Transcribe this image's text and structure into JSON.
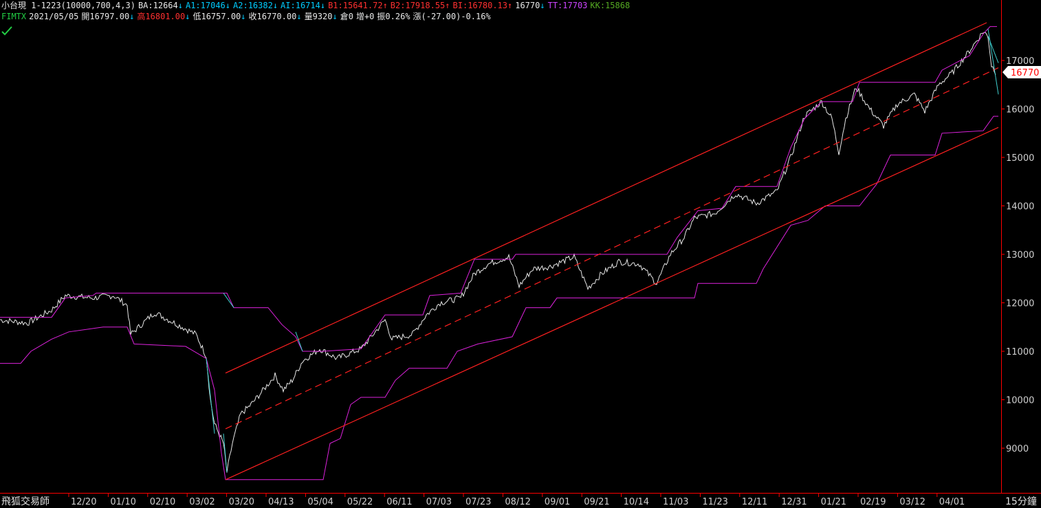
{
  "header1": [
    {
      "text": "小台現 1-1223(10000,700,4,3)",
      "color": "#e8e8e8"
    },
    {
      "text": "BA:12664",
      "color": "#e8e8e8",
      "arrow": "down"
    },
    {
      "text": "A1:17046",
      "color": "#00ccff",
      "arrow": "down"
    },
    {
      "text": "A2:16382",
      "color": "#00ccff",
      "arrow": "down"
    },
    {
      "text": "AI:16714",
      "color": "#00ccff",
      "arrow": "down"
    },
    {
      "text": "B1:15641.72",
      "color": "#ff3030",
      "arrow": "up"
    },
    {
      "text": "B2:17918.55",
      "color": "#ff3030",
      "arrow": "up"
    },
    {
      "text": "BI:16780.13",
      "color": "#ff3030",
      "arrow": "up"
    },
    {
      "text": "16770",
      "color": "#e8e8e8",
      "arrow": "down"
    },
    {
      "text": "TT:17703",
      "color": "#cc44ff"
    },
    {
      "text": "KK:15868",
      "color": "#55aa22"
    }
  ],
  "header2": [
    {
      "text": "FIMTX",
      "color": "#22cc44"
    },
    {
      "text": "2021/05/05",
      "color": "#e8e8e8"
    },
    {
      "text": "開16797.00",
      "color": "#e8e8e8",
      "arrow": "down"
    },
    {
      "text": "高16801.00",
      "color": "#ff3030",
      "arrow": "down"
    },
    {
      "text": "低16757.00",
      "color": "#e8e8e8",
      "arrow": "down"
    },
    {
      "text": "收16770.00",
      "color": "#e8e8e8",
      "arrow": "down"
    },
    {
      "text": "量9320",
      "color": "#e8e8e8",
      "arrow": "down"
    },
    {
      "text": "倉0",
      "color": "#e8e8e8"
    },
    {
      "text": "增+0",
      "color": "#e8e8e8"
    },
    {
      "text": "振0.26%",
      "color": "#e8e8e8"
    },
    {
      "text": "漲(-27.00)-0.16%",
      "color": "#e8e8e8"
    }
  ],
  "brand": "飛狐交易師",
  "timeframe": "15分鐘",
  "last_price_tag": "16770",
  "colors": {
    "background": "#000000",
    "price": "#e8e8e8",
    "channel": "#ff2020",
    "envelope": "#dd22dd",
    "cyan": "#40d0d0"
  },
  "chart_data": {
    "type": "line",
    "x_ticks": [
      "12/20",
      "01/10",
      "02/10",
      "03/02",
      "03/20",
      "04/13",
      "05/04",
      "05/22",
      "06/11",
      "07/03",
      "07/23",
      "08/12",
      "09/01",
      "09/21",
      "10/14",
      "11/03",
      "11/23",
      "12/11",
      "12/31",
      "01/21",
      "02/19",
      "03/12",
      "04/01"
    ],
    "y_ticks": [
      9000,
      10000,
      11000,
      12000,
      13000,
      14000,
      15000,
      16000,
      17000
    ],
    "ylim": [
      8300,
      17850
    ],
    "last_price": 16770,
    "series": [
      {
        "name": "",
        "points": [
          [
            0,
            11650
          ],
          [
            40,
            11580
          ],
          [
            75,
            11850
          ],
          [
            95,
            12150
          ],
          [
            135,
            12100
          ],
          [
            165,
            12150
          ],
          [
            185,
            11950
          ],
          [
            190,
            11350
          ],
          [
            225,
            11800
          ],
          [
            265,
            11500
          ],
          [
            285,
            11350
          ],
          [
            300,
            10900
          ],
          [
            306,
            10000
          ],
          [
            312,
            9500
          ],
          [
            325,
            9100
          ],
          [
            330,
            8500
          ],
          [
            338,
            9100
          ],
          [
            350,
            9700
          ],
          [
            365,
            9900
          ],
          [
            380,
            10150
          ],
          [
            400,
            10500
          ],
          [
            412,
            10200
          ],
          [
            425,
            10400
          ],
          [
            440,
            10800
          ],
          [
            465,
            11050
          ],
          [
            490,
            10850
          ],
          [
            525,
            11050
          ],
          [
            540,
            11300
          ],
          [
            560,
            11650
          ],
          [
            570,
            11250
          ],
          [
            600,
            11350
          ],
          [
            620,
            11750
          ],
          [
            640,
            12000
          ],
          [
            670,
            12100
          ],
          [
            690,
            12600
          ],
          [
            710,
            12800
          ],
          [
            740,
            12950
          ],
          [
            755,
            12350
          ],
          [
            775,
            12700
          ],
          [
            800,
            12750
          ],
          [
            835,
            12950
          ],
          [
            855,
            12300
          ],
          [
            875,
            12600
          ],
          [
            900,
            12850
          ],
          [
            930,
            12800
          ],
          [
            955,
            12400
          ],
          [
            975,
            13000
          ],
          [
            995,
            13350
          ],
          [
            1010,
            13750
          ],
          [
            1040,
            13850
          ],
          [
            1070,
            14250
          ],
          [
            1100,
            14050
          ],
          [
            1130,
            14300
          ],
          [
            1150,
            15000
          ],
          [
            1170,
            15850
          ],
          [
            1195,
            16150
          ],
          [
            1210,
            15800
          ],
          [
            1220,
            15100
          ],
          [
            1230,
            15800
          ],
          [
            1245,
            16450
          ],
          [
            1265,
            16000
          ],
          [
            1285,
            15650
          ],
          [
            1305,
            16100
          ],
          [
            1330,
            16300
          ],
          [
            1345,
            15950
          ],
          [
            1365,
            16500
          ],
          [
            1385,
            16750
          ],
          [
            1410,
            17200
          ],
          [
            1430,
            17600
          ],
          [
            1437,
            17500
          ],
          [
            1442,
            16900
          ],
          [
            1448,
            16770
          ]
        ]
      },
      {
        "name": "",
        "points": [
          [
            0,
            11700
          ],
          [
            30,
            11700
          ],
          [
            75,
            11700
          ],
          [
            95,
            12100
          ],
          [
            135,
            12150
          ],
          [
            140,
            12200
          ],
          [
            330,
            12200
          ],
          [
            340,
            11900
          ],
          [
            390,
            11900
          ],
          [
            410,
            11550
          ],
          [
            430,
            11300
          ],
          [
            440,
            11000
          ],
          [
            470,
            11000
          ],
          [
            525,
            11050
          ],
          [
            540,
            11350
          ],
          [
            560,
            11750
          ],
          [
            615,
            11750
          ],
          [
            625,
            12150
          ],
          [
            670,
            12200
          ],
          [
            690,
            12900
          ],
          [
            745,
            12900
          ],
          [
            750,
            13000
          ],
          [
            970,
            13000
          ],
          [
            985,
            13350
          ],
          [
            1015,
            13900
          ],
          [
            1050,
            13950
          ],
          [
            1070,
            14400
          ],
          [
            1130,
            14400
          ],
          [
            1150,
            15200
          ],
          [
            1170,
            15800
          ],
          [
            1195,
            16150
          ],
          [
            1240,
            16150
          ],
          [
            1250,
            16550
          ],
          [
            1360,
            16550
          ],
          [
            1370,
            16800
          ],
          [
            1410,
            17100
          ],
          [
            1430,
            17550
          ],
          [
            1440,
            17700
          ],
          [
            1450,
            17700
          ]
        ]
      },
      {
        "name": "",
        "points": [
          [
            0,
            10750
          ],
          [
            30,
            10750
          ],
          [
            45,
            11000
          ],
          [
            75,
            11250
          ],
          [
            100,
            11400
          ],
          [
            150,
            11500
          ],
          [
            185,
            11500
          ],
          [
            195,
            11150
          ],
          [
            270,
            11100
          ],
          [
            300,
            10850
          ],
          [
            312,
            10200
          ],
          [
            322,
            8900
          ],
          [
            328,
            8350
          ],
          [
            470,
            8350
          ],
          [
            480,
            9100
          ],
          [
            495,
            9200
          ],
          [
            510,
            9900
          ],
          [
            525,
            10050
          ],
          [
            560,
            10050
          ],
          [
            575,
            10400
          ],
          [
            595,
            10650
          ],
          [
            650,
            10650
          ],
          [
            665,
            11000
          ],
          [
            695,
            11150
          ],
          [
            745,
            11300
          ],
          [
            765,
            11900
          ],
          [
            800,
            11900
          ],
          [
            810,
            12100
          ],
          [
            1010,
            12100
          ],
          [
            1015,
            12400
          ],
          [
            1100,
            12400
          ],
          [
            1110,
            12700
          ],
          [
            1130,
            13150
          ],
          [
            1150,
            13600
          ],
          [
            1175,
            13700
          ],
          [
            1200,
            14000
          ],
          [
            1250,
            14000
          ],
          [
            1275,
            14450
          ],
          [
            1295,
            15050
          ],
          [
            1360,
            15050
          ],
          [
            1370,
            15500
          ],
          [
            1430,
            15550
          ],
          [
            1445,
            15850
          ],
          [
            1452,
            15850
          ]
        ]
      },
      {
        "name": "",
        "points": [
          [
            328,
            10550
          ],
          [
            1435,
            17780
          ]
        ]
      },
      {
        "name": "",
        "points": [
          [
            328,
            9400
          ],
          [
            1452,
            16850
          ]
        ]
      },
      {
        "name": "",
        "points": [
          [
            328,
            8350
          ],
          [
            1452,
            15620
          ]
        ]
      }
    ]
  }
}
